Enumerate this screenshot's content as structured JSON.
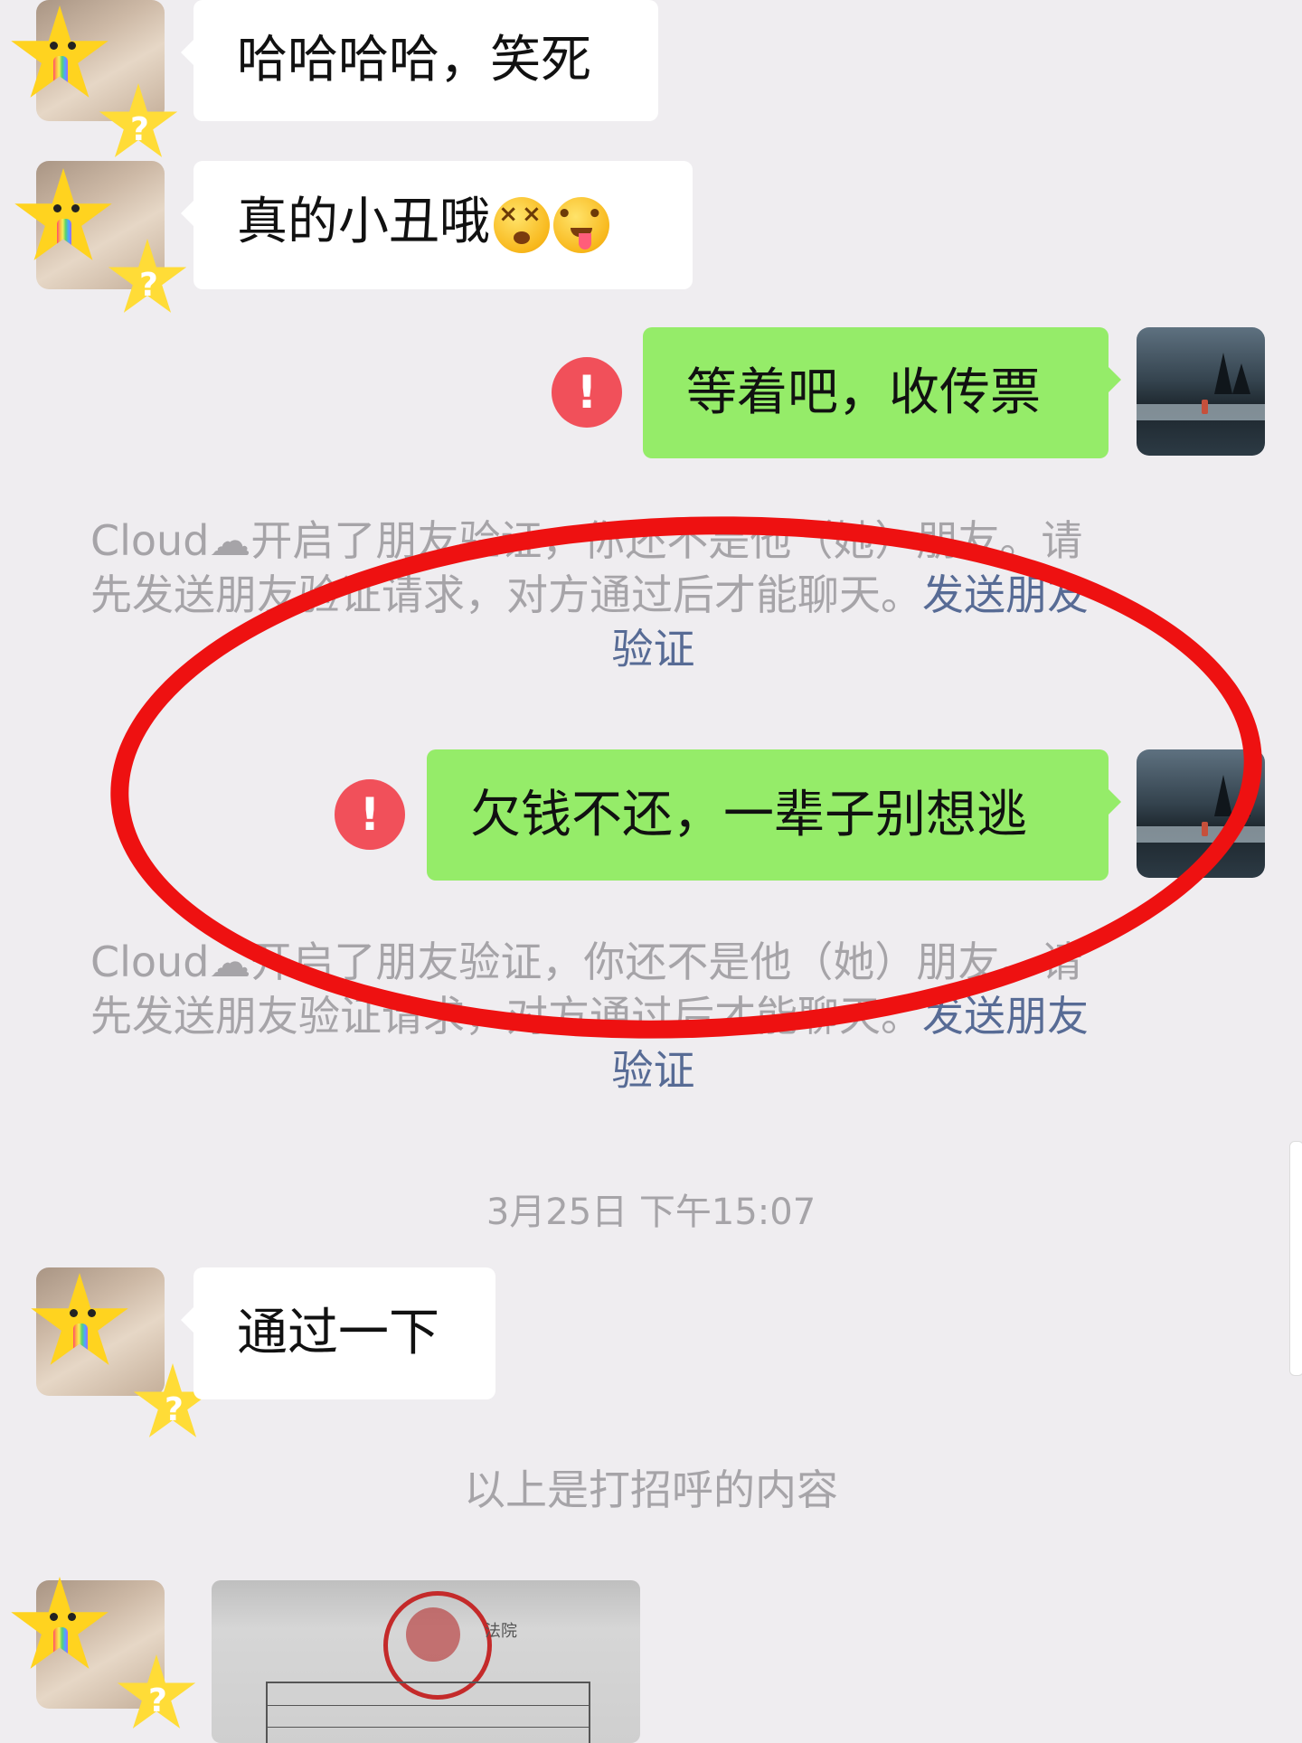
{
  "messages": {
    "m1": {
      "text": "哈哈哈哈，笑死"
    },
    "m2": {
      "text": "真的小丑哦",
      "emojis": [
        "dizzy-face-emoji",
        "tongue-out-emoji"
      ]
    },
    "m3": {
      "text": "等着吧，收传票",
      "status_icon": "exclamation-error-icon"
    },
    "m4": {
      "text": "欠钱不还，一辈子别想逃",
      "status_icon": "exclamation-error-icon"
    },
    "m5": {
      "text": "通过一下"
    }
  },
  "system_notice": {
    "line1": "Cloud☁开启了朋友验证，你还不是他（她）朋友。请",
    "line2": "先发送朋友验证请求，对方通过后才能聊天。",
    "link_part1": "发送朋友",
    "link_part2": "验证"
  },
  "timestamp": "3月25日 下午15:07",
  "greeting_note": "以上是打招呼的内容",
  "photo": {
    "court_label": "法院"
  },
  "colors": {
    "outgoing_bubble": "#95ec69",
    "incoming_bubble": "#ffffff",
    "background": "#efedf0",
    "error": "#f1505a",
    "link": "#576b95",
    "annotation": "#ee1111"
  }
}
